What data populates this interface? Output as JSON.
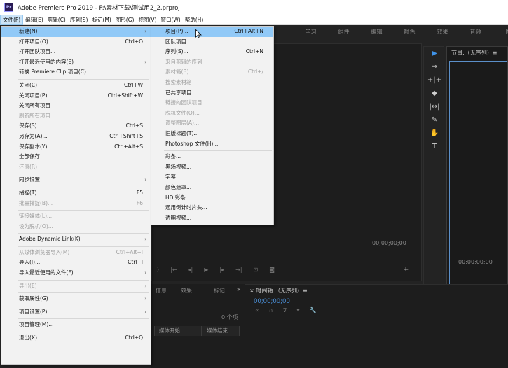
{
  "titlebar": {
    "icon_text": "Pr",
    "title": "Adobe Premiere Pro 2019 - F:\\素材下载\\测试用2_2.prproj"
  },
  "menubar": [
    {
      "label": "文件(F)",
      "active": true
    },
    {
      "label": "编辑(E)"
    },
    {
      "label": "剪辑(C)"
    },
    {
      "label": "序列(S)"
    },
    {
      "label": "标记(M)"
    },
    {
      "label": "图形(G)"
    },
    {
      "label": "视图(V)"
    },
    {
      "label": "窗口(W)"
    },
    {
      "label": "帮助(H)"
    }
  ],
  "workspaces": [
    "学习",
    "组件",
    "编辑",
    "颜色",
    "效果",
    "音频",
    "图"
  ],
  "file_menu": [
    {
      "label": "新建(N)",
      "arrow": "›",
      "highlight": true
    },
    {
      "label": "打开项目(O)...",
      "shortcut": "Ctrl+O"
    },
    {
      "label": "打开团队项目..."
    },
    {
      "label": "打开最近使用的内容(E)",
      "arrow": "›"
    },
    {
      "label": "转换 Premiere Clip 项目(C)..."
    },
    {
      "sep": true
    },
    {
      "label": "关闭(C)",
      "shortcut": "Ctrl+W"
    },
    {
      "label": "关闭项目(P)",
      "shortcut": "Ctrl+Shift+W"
    },
    {
      "label": "关闭所有项目"
    },
    {
      "label": "刷新所有项目",
      "disabled": true
    },
    {
      "label": "保存(S)",
      "shortcut": "Ctrl+S"
    },
    {
      "label": "另存为(A)...",
      "shortcut": "Ctrl+Shift+S"
    },
    {
      "label": "保存副本(Y)...",
      "shortcut": "Ctrl+Alt+S"
    },
    {
      "label": "全部保存"
    },
    {
      "label": "还原(R)",
      "disabled": true
    },
    {
      "sep": true
    },
    {
      "label": "同步设置",
      "arrow": "›"
    },
    {
      "sep": true
    },
    {
      "label": "捕捉(T)...",
      "shortcut": "F5"
    },
    {
      "label": "批量捕捉(B)...",
      "shortcut": "F6",
      "disabled": true
    },
    {
      "sep": true
    },
    {
      "label": "链接媒体(L)...",
      "disabled": true
    },
    {
      "label": "设为脱机(O)...",
      "disabled": true
    },
    {
      "sep": true
    },
    {
      "label": "Adobe Dynamic Link(K)",
      "arrow": "›"
    },
    {
      "sep": true
    },
    {
      "label": "从媒体浏览器导入(M)",
      "shortcut": "Ctrl+Alt+I",
      "disabled": true
    },
    {
      "label": "导入(I)...",
      "shortcut": "Ctrl+I"
    },
    {
      "label": "导入最近使用的文件(F)",
      "arrow": "›"
    },
    {
      "sep": true
    },
    {
      "label": "导出(E)",
      "arrow": "›",
      "disabled": true
    },
    {
      "sep": true
    },
    {
      "label": "获取属性(G)",
      "arrow": "›"
    },
    {
      "sep": true
    },
    {
      "label": "项目设置(P)",
      "arrow": "›"
    },
    {
      "sep": true
    },
    {
      "label": "项目管理(M)..."
    },
    {
      "sep": true
    },
    {
      "label": "退出(X)",
      "shortcut": "Ctrl+Q"
    }
  ],
  "new_submenu": [
    {
      "label": "项目(P)...",
      "shortcut": "Ctrl+Alt+N",
      "highlight": true
    },
    {
      "label": "团队项目..."
    },
    {
      "label": "序列(S)...",
      "shortcut": "Ctrl+N"
    },
    {
      "label": "来自剪辑的序列",
      "disabled": true
    },
    {
      "label": "素材箱(B)",
      "shortcut": "Ctrl+/",
      "disabled": true
    },
    {
      "label": "搜索素材箱",
      "disabled": true
    },
    {
      "label": "已共享项目"
    },
    {
      "label": "链接的团队项目...",
      "disabled": true
    },
    {
      "label": "脱机文件(O)...",
      "disabled": true
    },
    {
      "label": "调整图层(A)...",
      "disabled": true
    },
    {
      "label": "旧版标题(T)..."
    },
    {
      "label": "Photoshop 文件(H)..."
    },
    {
      "sep": true
    },
    {
      "label": "彩条..."
    },
    {
      "label": "黑场视频..."
    },
    {
      "label": "字幕..."
    },
    {
      "label": "颜色遮罩..."
    },
    {
      "label": "HD 彩条..."
    },
    {
      "label": "通用倒计时片头..."
    },
    {
      "label": "透明视频..."
    }
  ],
  "program_monitor": {
    "title": "节目:（无序列）≡",
    "timecode": "00;00;00;00"
  },
  "source_timecode": "00;00;00;00",
  "panels": {
    "effects_tab": "效果",
    "markers_tab": "标记",
    "more": "»",
    "info_tab": "信息",
    "timeline_tab": "× 时间轴:（无序列）≡",
    "timeline_timecode": "00;00;00;00",
    "item_count": "0 个项",
    "media_start": "媒体开始",
    "media_end": "媒体结束"
  },
  "icons": {
    "tools": [
      "selection-arrow-icon",
      "track-select-icon",
      "ripple-edit-icon",
      "razor-icon",
      "slip-icon",
      "pen-icon",
      "hand-icon",
      "type-icon"
    ]
  }
}
